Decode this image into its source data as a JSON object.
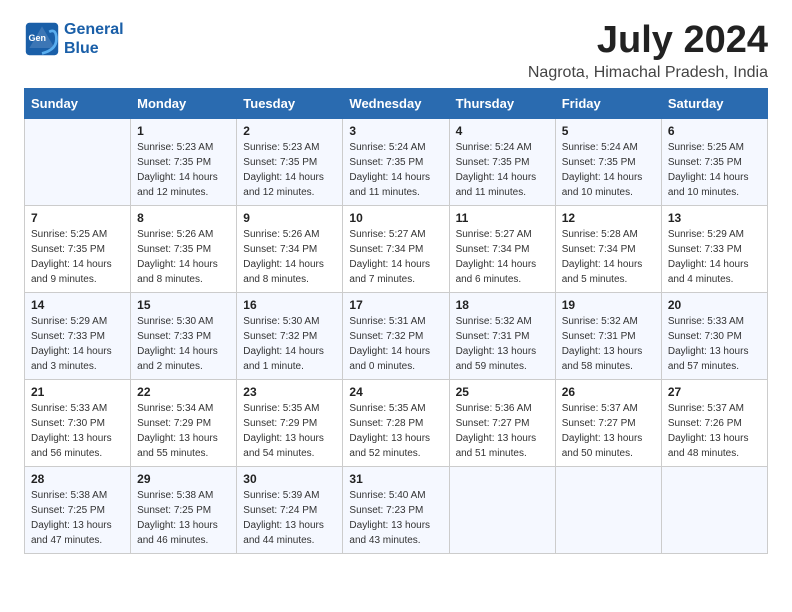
{
  "logo": {
    "line1": "General",
    "line2": "Blue"
  },
  "title": "July 2024",
  "location": "Nagrota, Himachal Pradesh, India",
  "days_of_week": [
    "Sunday",
    "Monday",
    "Tuesday",
    "Wednesday",
    "Thursday",
    "Friday",
    "Saturday"
  ],
  "weeks": [
    [
      {
        "num": "",
        "info": ""
      },
      {
        "num": "1",
        "info": "Sunrise: 5:23 AM\nSunset: 7:35 PM\nDaylight: 14 hours\nand 12 minutes."
      },
      {
        "num": "2",
        "info": "Sunrise: 5:23 AM\nSunset: 7:35 PM\nDaylight: 14 hours\nand 12 minutes."
      },
      {
        "num": "3",
        "info": "Sunrise: 5:24 AM\nSunset: 7:35 PM\nDaylight: 14 hours\nand 11 minutes."
      },
      {
        "num": "4",
        "info": "Sunrise: 5:24 AM\nSunset: 7:35 PM\nDaylight: 14 hours\nand 11 minutes."
      },
      {
        "num": "5",
        "info": "Sunrise: 5:24 AM\nSunset: 7:35 PM\nDaylight: 14 hours\nand 10 minutes."
      },
      {
        "num": "6",
        "info": "Sunrise: 5:25 AM\nSunset: 7:35 PM\nDaylight: 14 hours\nand 10 minutes."
      }
    ],
    [
      {
        "num": "7",
        "info": "Sunrise: 5:25 AM\nSunset: 7:35 PM\nDaylight: 14 hours\nand 9 minutes."
      },
      {
        "num": "8",
        "info": "Sunrise: 5:26 AM\nSunset: 7:35 PM\nDaylight: 14 hours\nand 8 minutes."
      },
      {
        "num": "9",
        "info": "Sunrise: 5:26 AM\nSunset: 7:34 PM\nDaylight: 14 hours\nand 8 minutes."
      },
      {
        "num": "10",
        "info": "Sunrise: 5:27 AM\nSunset: 7:34 PM\nDaylight: 14 hours\nand 7 minutes."
      },
      {
        "num": "11",
        "info": "Sunrise: 5:27 AM\nSunset: 7:34 PM\nDaylight: 14 hours\nand 6 minutes."
      },
      {
        "num": "12",
        "info": "Sunrise: 5:28 AM\nSunset: 7:34 PM\nDaylight: 14 hours\nand 5 minutes."
      },
      {
        "num": "13",
        "info": "Sunrise: 5:29 AM\nSunset: 7:33 PM\nDaylight: 14 hours\nand 4 minutes."
      }
    ],
    [
      {
        "num": "14",
        "info": "Sunrise: 5:29 AM\nSunset: 7:33 PM\nDaylight: 14 hours\nand 3 minutes."
      },
      {
        "num": "15",
        "info": "Sunrise: 5:30 AM\nSunset: 7:33 PM\nDaylight: 14 hours\nand 2 minutes."
      },
      {
        "num": "16",
        "info": "Sunrise: 5:30 AM\nSunset: 7:32 PM\nDaylight: 14 hours\nand 1 minute."
      },
      {
        "num": "17",
        "info": "Sunrise: 5:31 AM\nSunset: 7:32 PM\nDaylight: 14 hours\nand 0 minutes."
      },
      {
        "num": "18",
        "info": "Sunrise: 5:32 AM\nSunset: 7:31 PM\nDaylight: 13 hours\nand 59 minutes."
      },
      {
        "num": "19",
        "info": "Sunrise: 5:32 AM\nSunset: 7:31 PM\nDaylight: 13 hours\nand 58 minutes."
      },
      {
        "num": "20",
        "info": "Sunrise: 5:33 AM\nSunset: 7:30 PM\nDaylight: 13 hours\nand 57 minutes."
      }
    ],
    [
      {
        "num": "21",
        "info": "Sunrise: 5:33 AM\nSunset: 7:30 PM\nDaylight: 13 hours\nand 56 minutes."
      },
      {
        "num": "22",
        "info": "Sunrise: 5:34 AM\nSunset: 7:29 PM\nDaylight: 13 hours\nand 55 minutes."
      },
      {
        "num": "23",
        "info": "Sunrise: 5:35 AM\nSunset: 7:29 PM\nDaylight: 13 hours\nand 54 minutes."
      },
      {
        "num": "24",
        "info": "Sunrise: 5:35 AM\nSunset: 7:28 PM\nDaylight: 13 hours\nand 52 minutes."
      },
      {
        "num": "25",
        "info": "Sunrise: 5:36 AM\nSunset: 7:27 PM\nDaylight: 13 hours\nand 51 minutes."
      },
      {
        "num": "26",
        "info": "Sunrise: 5:37 AM\nSunset: 7:27 PM\nDaylight: 13 hours\nand 50 minutes."
      },
      {
        "num": "27",
        "info": "Sunrise: 5:37 AM\nSunset: 7:26 PM\nDaylight: 13 hours\nand 48 minutes."
      }
    ],
    [
      {
        "num": "28",
        "info": "Sunrise: 5:38 AM\nSunset: 7:25 PM\nDaylight: 13 hours\nand 47 minutes."
      },
      {
        "num": "29",
        "info": "Sunrise: 5:38 AM\nSunset: 7:25 PM\nDaylight: 13 hours\nand 46 minutes."
      },
      {
        "num": "30",
        "info": "Sunrise: 5:39 AM\nSunset: 7:24 PM\nDaylight: 13 hours\nand 44 minutes."
      },
      {
        "num": "31",
        "info": "Sunrise: 5:40 AM\nSunset: 7:23 PM\nDaylight: 13 hours\nand 43 minutes."
      },
      {
        "num": "",
        "info": ""
      },
      {
        "num": "",
        "info": ""
      },
      {
        "num": "",
        "info": ""
      }
    ]
  ]
}
